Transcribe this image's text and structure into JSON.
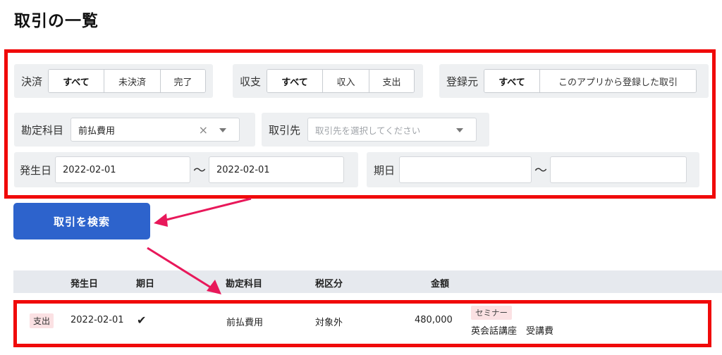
{
  "page": {
    "title": "取引の一覧"
  },
  "filters": {
    "settlement": {
      "label": "決済",
      "options": [
        "すべて",
        "未決済",
        "完了"
      ],
      "selected": "すべて"
    },
    "income_expense": {
      "label": "収支",
      "options": [
        "すべて",
        "収入",
        "支出"
      ],
      "selected": "すべて"
    },
    "source": {
      "label": "登録元",
      "options": [
        "すべて",
        "このアプリから登録した取引"
      ],
      "selected": "すべて"
    },
    "account_item": {
      "label": "勘定科目",
      "value": "前払費用",
      "clear_icon": "×"
    },
    "partner": {
      "label": "取引先",
      "placeholder": "取引先を選択してください"
    },
    "issue_date": {
      "label": "発生日",
      "from": "2022-02-01",
      "to": "2022-02-01",
      "separator": "〜"
    },
    "due_date": {
      "label": "期日",
      "from": "",
      "to": "",
      "separator": "〜"
    }
  },
  "search_button": {
    "label": "取引を検索"
  },
  "table": {
    "headers": {
      "issue_date": "発生日",
      "due_date": "期日",
      "account_item": "勘定科目",
      "tax": "税区分",
      "amount": "金額"
    },
    "rows": [
      {
        "type": "支出",
        "issue_date": "2022-02-01",
        "due_check": "✔",
        "account_item": "前払費用",
        "tax": "対象外",
        "amount": "480,000",
        "tag": "セミナー",
        "description": "英会話講座　受講費"
      }
    ]
  },
  "colors": {
    "highlight": "#f00a0a",
    "primary": "#2d63cc",
    "arrow": "#e8185a",
    "badge_bg": "#fbe1e3"
  }
}
